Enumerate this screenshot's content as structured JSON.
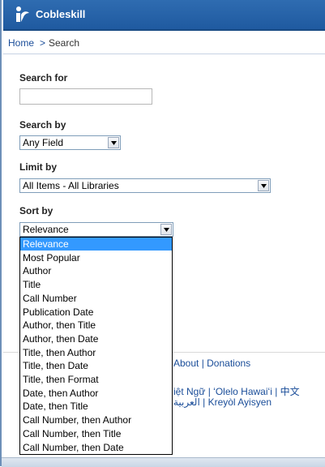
{
  "header": {
    "title": "Cobleskill"
  },
  "breadcrumb": {
    "home": "Home",
    "separator": ">",
    "current": "Search"
  },
  "form": {
    "search_for_label": "Search for",
    "search_for_value": "",
    "search_by_label": "Search by",
    "search_by_value": "Any Field",
    "limit_by_label": "Limit by",
    "limit_by_value": "All Items - All Libraries",
    "sort_by_label": "Sort by",
    "sort_by_value": "Relevance"
  },
  "sort_options": [
    "Relevance",
    "Most Popular",
    "Author",
    "Title",
    "Call Number",
    "Publication Date",
    "Author, then Title",
    "Author, then Date",
    "Title, then Author",
    "Title, then Date",
    "Title, then Format",
    "Date, then Author",
    "Date, then Title",
    "Call Number, then Author",
    "Call Number, then Title",
    "Call Number, then Date"
  ],
  "footer": {
    "links": "About | Donations",
    "languages_line1": "iệt Ngữ | ʻOlelo Hawaiʻi | 中文",
    "languages_line2": "العربية | Kreyòl Ayisyen"
  },
  "colors": {
    "header": "#1f5aa0",
    "link": "#1a4d99",
    "selected": "#3399ff"
  }
}
